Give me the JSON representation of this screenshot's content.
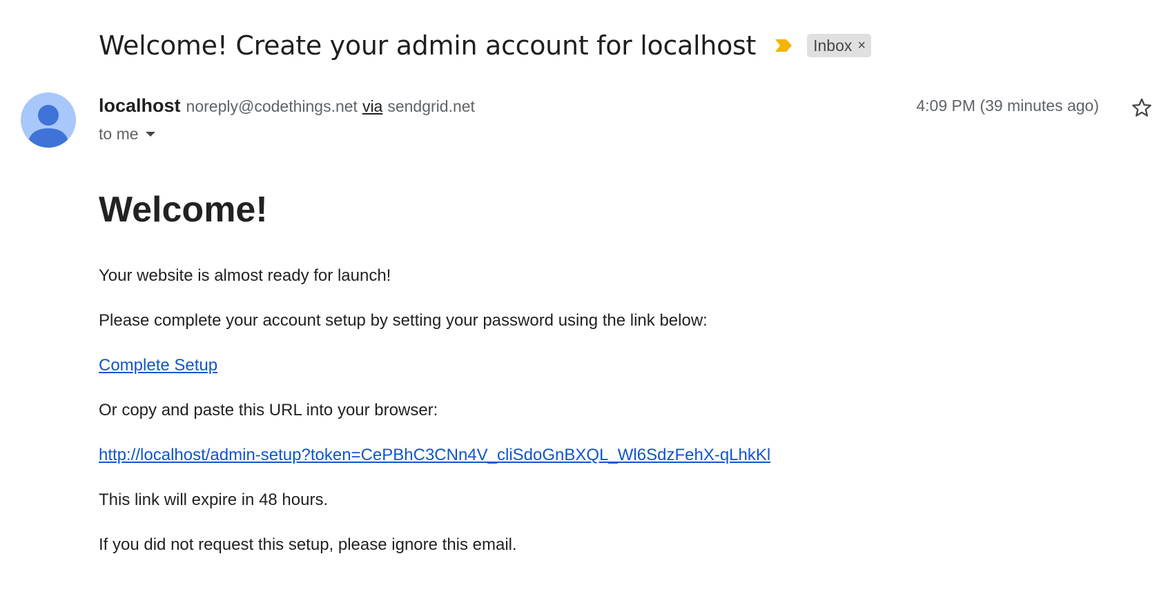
{
  "email": {
    "subject": "Welcome! Create your admin account for localhost",
    "label": "Inbox",
    "label_close": "×",
    "sender_name": "localhost",
    "sender_email": "noreply@codethings.net",
    "via": "via",
    "via_domain": "sendgrid.net",
    "recipient": "to me",
    "timestamp": "4:09 PM (39 minutes ago)"
  },
  "body": {
    "heading": "Welcome!",
    "line1": "Your website is almost ready for launch!",
    "line2": "Please complete your account setup by setting your password using the link below:",
    "setup_link": "Complete Setup",
    "line3": "Or copy and paste this URL into your browser:",
    "setup_url": "http://localhost/admin-setup?token=CePBhC3CNn4V_cliSdoGnBXQL_Wl6SdzFehX-qLhkKl",
    "line4": "This link will expire in 48 hours.",
    "line5": "If you did not request this setup, please ignore this email."
  },
  "icons": {
    "importance": "importance-marker-icon",
    "star": "star-icon",
    "avatar": "person-avatar-icon",
    "caret": "caret-down-icon"
  },
  "colors": {
    "importance": "#f4b400",
    "avatar_bg": "#a8c7fa",
    "avatar_fg": "#3f73d8",
    "link": "#1155cc",
    "label_bg": "#e0e0e0"
  }
}
